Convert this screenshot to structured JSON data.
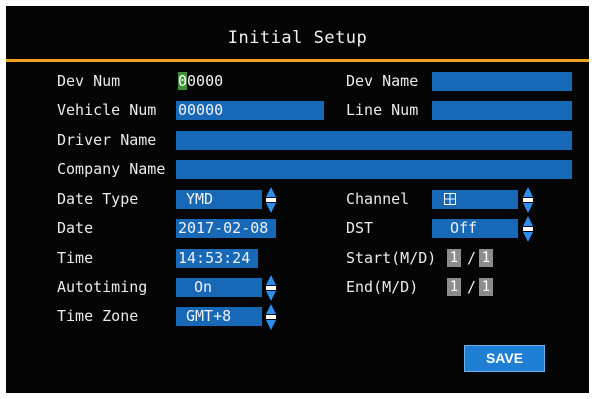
{
  "title": "Initial Setup",
  "colors": {
    "field_bg": "#1769b8",
    "accent_line": "#f0a020",
    "cursor": "#3f8f3a",
    "save_button": "#1e7fd4"
  },
  "fields": {
    "dev_num": {
      "label": "Dev Num",
      "value": "00000"
    },
    "dev_name": {
      "label": "Dev Name",
      "value": ""
    },
    "vehicle_num": {
      "label": "Vehicle Num",
      "value": "00000"
    },
    "line_num": {
      "label": "Line Num",
      "value": ""
    },
    "driver_name": {
      "label": "Driver Name",
      "value": ""
    },
    "company_name": {
      "label": "Company Name",
      "value": ""
    },
    "date_type": {
      "label": "Date Type",
      "value": "YMD"
    },
    "channel": {
      "label": "Channel",
      "icon": "grid-icon"
    },
    "date": {
      "label": "Date",
      "value": "2017-02-08"
    },
    "dst": {
      "label": "DST",
      "value": "Off"
    },
    "time": {
      "label": "Time",
      "value": "14:53:24"
    },
    "start": {
      "label": "Start(M/D)",
      "month": "1",
      "day": "1",
      "separator": "/"
    },
    "autotiming": {
      "label": "Autotiming",
      "value": "On"
    },
    "end": {
      "label": "End(M/D)",
      "month": "1",
      "day": "1",
      "separator": "/"
    },
    "time_zone": {
      "label": "Time Zone",
      "value": "GMT+8"
    }
  },
  "save_label": "SAVE"
}
